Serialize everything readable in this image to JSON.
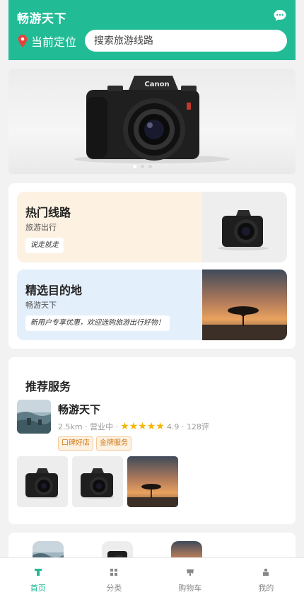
{
  "header": {
    "brand": "畅游天下",
    "message_icon": "chat-bubble-icon",
    "location_icon": "map-pin-icon",
    "location_label": "当前定位",
    "search_placeholder": "搜索旅游线路"
  },
  "banner": {
    "image": "camera-photo",
    "dots_count": 3,
    "active_dot": 0
  },
  "cards": [
    {
      "title": "热门线路",
      "subtitle": "旅游出行",
      "tag": "说走就走",
      "image": "camera-photo"
    },
    {
      "title": "精选目的地",
      "subtitle": "畅游天下",
      "tag": "新用户专享优惠，欢迎选购旅游出行好物！",
      "image": "savanna-sunset-photo"
    }
  ],
  "service": {
    "section_title": "推荐服务",
    "shop": {
      "name": "畅游天下",
      "distance": "2.5km",
      "status": "营业中",
      "stars": "★★★★★",
      "rating": "4.9",
      "reviews": "128评",
      "badges": [
        "口碑好店",
        "金牌服务"
      ]
    },
    "photos": [
      "camera-photo",
      "camera-photo",
      "savanna-sunset-photo"
    ]
  },
  "tabbar": {
    "items": [
      {
        "label": "首页",
        "icon": "home-icon",
        "active": true
      },
      {
        "label": "分类",
        "icon": "grid-icon",
        "active": false
      },
      {
        "label": "购物车",
        "icon": "cart-icon",
        "active": false
      },
      {
        "label": "我的",
        "icon": "user-icon",
        "active": false
      }
    ],
    "accent_color": "#21bb95"
  },
  "colors": {
    "brand": "#21bb95",
    "hot_card_bg": "#fdf1e2",
    "dest_card_bg": "#e3effb",
    "star": "#f7b500",
    "badge_text": "#d07a16"
  }
}
